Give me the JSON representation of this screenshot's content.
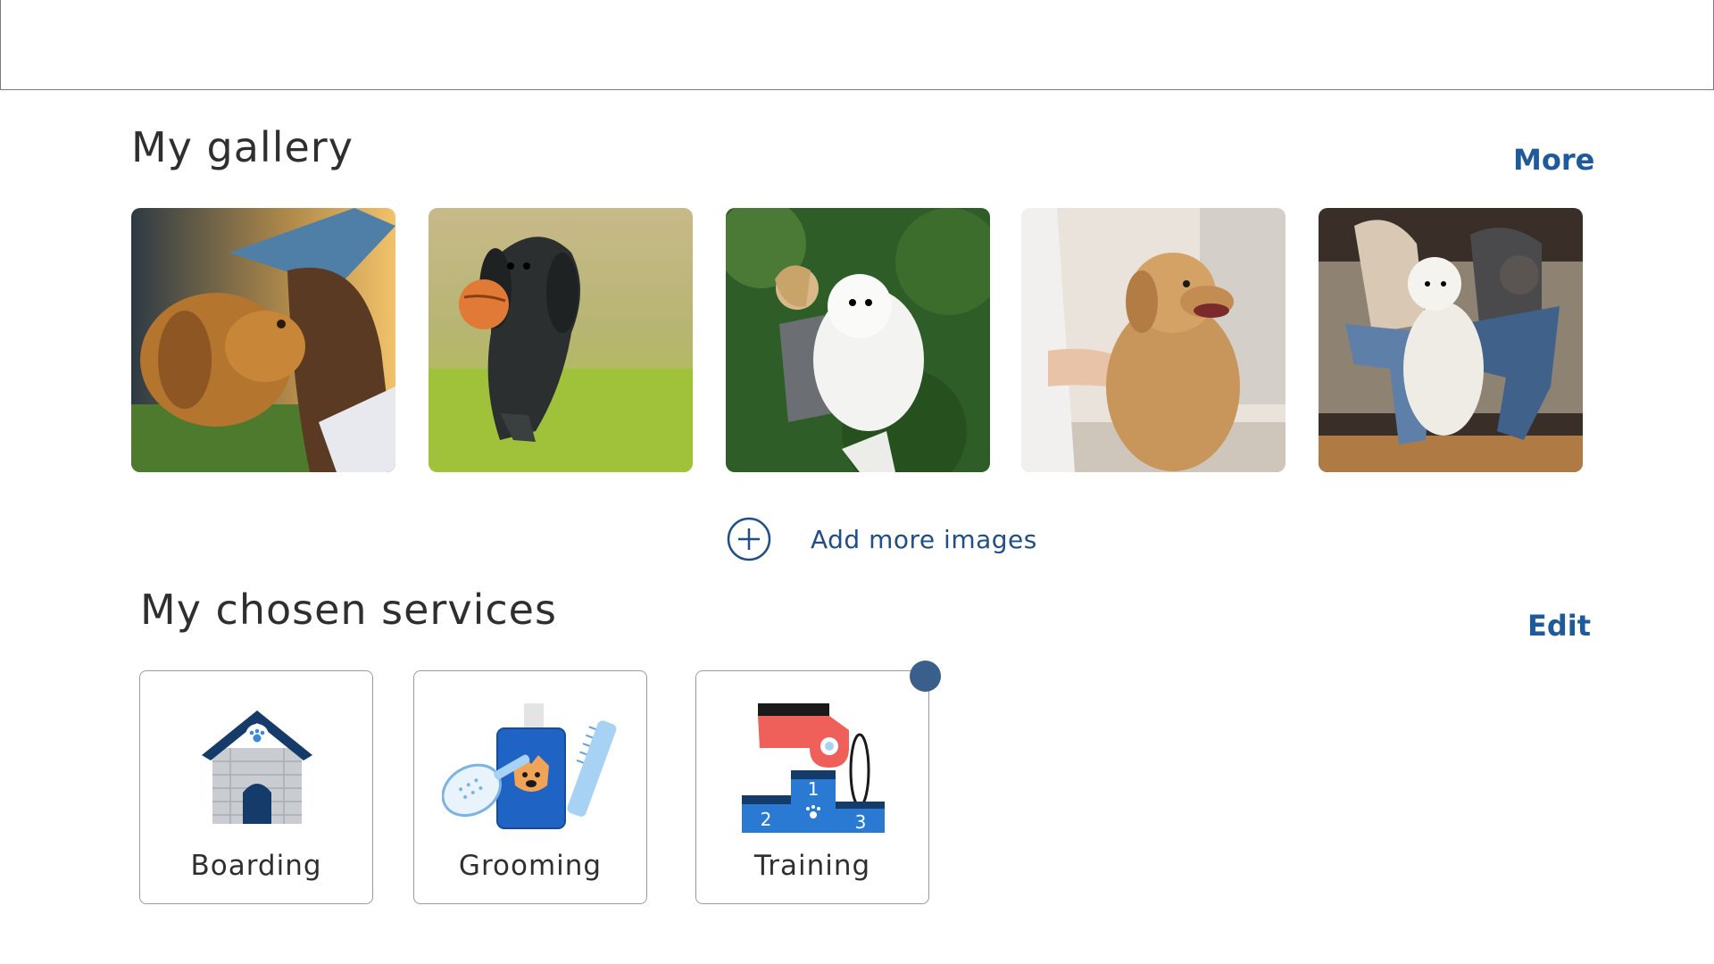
{
  "gallery": {
    "title": "My gallery",
    "more_label": "More",
    "images": [
      {
        "alt": "golden-retriever-with-woman-photo"
      },
      {
        "alt": "spaniel-running-with-ball-photo"
      },
      {
        "alt": "woman-holding-samoyed-photo"
      },
      {
        "alt": "golden-retriever-being-petted-photo"
      },
      {
        "alt": "couple-with-poodle-on-couch-photo"
      }
    ],
    "add_more_label": "Add more images"
  },
  "services": {
    "title": "My chosen services",
    "edit_label": "Edit",
    "items": [
      {
        "label": "Boarding",
        "icon": "dog-house-icon"
      },
      {
        "label": "Grooming",
        "icon": "grooming-kit-icon"
      },
      {
        "label": "Training",
        "icon": "training-podium-whistle-icon"
      }
    ],
    "podium_places": [
      "1",
      "2",
      "3"
    ]
  },
  "colors": {
    "accent": "#1f5b9b",
    "dot": "#3a5f8a"
  }
}
